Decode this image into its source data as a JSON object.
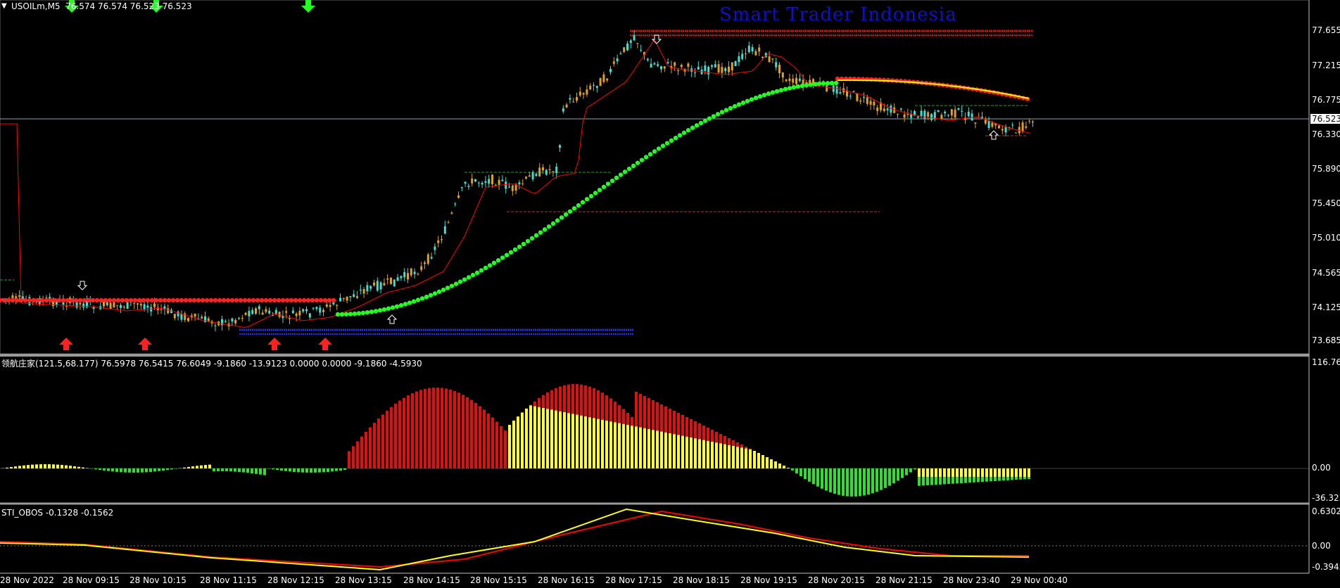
{
  "main_panel": {
    "header": "USOILm,M5  76.574 76.574 76.523 76.523",
    "watermark": "Smart Trader Indonesia",
    "current_price_tag": "76.523",
    "price_axis_labels": [
      "77.655",
      "77.215",
      "76.775",
      "76.330",
      "75.890",
      "75.450",
      "75.010",
      "74.565",
      "74.125",
      "73.685"
    ]
  },
  "osc_panel_1": {
    "header": "领航庄家(121.5,68.177) 76.5978 76.5415 76.6049 -9.1860 -13.9123 0.0000 0.0000 -9.1860 -4.5930",
    "axis_labels": [
      "116.768",
      "0.00",
      "-36.3232"
    ]
  },
  "osc_panel_2": {
    "header": "STI_OBOS -0.1328 -0.1562",
    "axis_labels": [
      "0.6302",
      "0.00",
      "-0.3945"
    ]
  },
  "time_axis_labels": [
    "28 Nov 2022",
    "28 Nov 09:15",
    "28 Nov 10:15",
    "28 Nov 11:15",
    "28 Nov 12:15",
    "28 Nov 13:15",
    "28 Nov 14:15",
    "28 Nov 15:15",
    "28 Nov 16:15",
    "28 Nov 17:15",
    "28 Nov 18:15",
    "28 Nov 19:15",
    "28 Nov 20:15",
    "28 Nov 21:15",
    "28 Nov 23:40",
    "29 Nov 00:40"
  ],
  "colors": {
    "bull_candle": "#e0a020",
    "bear_candle": "#40e0d0",
    "red_dots": "#ff2020",
    "green_dots": "#20ff20",
    "yellow_line": "#ffff00",
    "red_line": "#ff0000",
    "blue_level": "#1f2fff",
    "hist_red": "#e01010",
    "hist_yellow": "#ffff30",
    "hist_green": "#30e030"
  },
  "icons": [
    "down-arrow-icon",
    "up-arrow-icon",
    "dropdown-triangle-icon"
  ]
}
